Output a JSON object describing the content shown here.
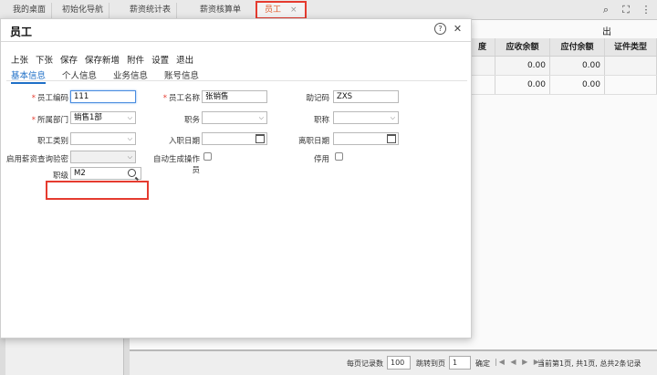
{
  "tabs": [
    {
      "label": "我的桌面"
    },
    {
      "label": "初始化导航"
    },
    {
      "label": "薪资统计表"
    },
    {
      "label": "薪资核算单"
    },
    {
      "label": "员工",
      "close": "×"
    }
  ],
  "background": {
    "export_label": "出",
    "columns": [
      "度",
      "应收余额",
      "应付余额",
      "证件类型"
    ],
    "rows": [
      {
        "recv": "0.00",
        "pay": "0.00"
      },
      {
        "recv": "0.00",
        "pay": "0.00"
      }
    ],
    "pager": {
      "per_page_label": "每页记录数",
      "per_page": "100",
      "jump_label": "跳转到页",
      "page": "1",
      "confirm": "确定",
      "status": "当前第1页, 共1页, 总共2条记录"
    }
  },
  "dialog": {
    "title": "员工",
    "toolbar": [
      "上张",
      "下张",
      "保存",
      "保存新增",
      "附件",
      "设置",
      "退出"
    ],
    "subtabs": [
      "基本信息",
      "个人信息",
      "业务信息",
      "账号信息"
    ],
    "fields": {
      "code_label": "员工编码",
      "code_value": "111",
      "name_label": "员工名称",
      "name_value": "张销售",
      "mnemonic_label": "助记码",
      "mnemonic_value": "ZXS",
      "dept_label": "所属部门",
      "dept_value": "销售1部",
      "duty_label": "职务",
      "title_label": "职称",
      "category_label": "职工类别",
      "hire_label": "入职日期",
      "leave_label": "离职日期",
      "salary_query_label": "启用薪资查询验密",
      "auto_operator_label": "自动生成操作员",
      "disabled_label": "停用",
      "grade_label": "职级",
      "grade_value": "M2"
    }
  }
}
